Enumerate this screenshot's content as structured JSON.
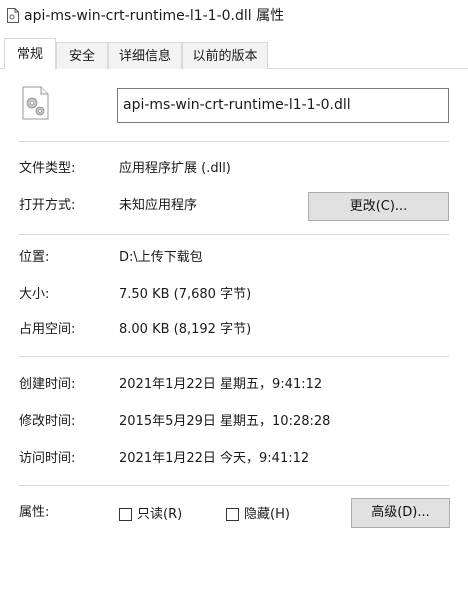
{
  "window": {
    "title": "api-ms-win-crt-runtime-l1-1-0.dll 属性",
    "icon": "dll-file-icon"
  },
  "tabs": [
    {
      "label": "常规",
      "active": true
    },
    {
      "label": "安全",
      "active": false
    },
    {
      "label": "详细信息",
      "active": false
    },
    {
      "label": "以前的版本",
      "active": false
    }
  ],
  "general": {
    "file_name": "api-ms-win-crt-runtime-l1-1-0.dll",
    "file_type_label": "文件类型:",
    "file_type_value": "应用程序扩展 (.dll)",
    "opens_with_label": "打开方式:",
    "opens_with_value": "未知应用程序",
    "change_button": "更改(C)...",
    "location_label": "位置:",
    "location_value": "D:\\上传下载包",
    "size_label": "大小:",
    "size_value": "7.50 KB (7,680 字节)",
    "size_on_disk_label": "占用空间:",
    "size_on_disk_value": "8.00 KB (8,192 字节)",
    "created_label": "创建时间:",
    "created_value": "2021年1月22日 星期五，9:41:12",
    "modified_label": "修改时间:",
    "modified_value": "2015年5月29日 星期五，10:28:28",
    "accessed_label": "访问时间:",
    "accessed_value": "2021年1月22日 今天，9:41:12",
    "attributes_label": "属性:",
    "readonly_label": "只读(R)",
    "readonly_checked": false,
    "hidden_label": "隐藏(H)",
    "hidden_checked": false,
    "advanced_button": "高级(D)..."
  }
}
